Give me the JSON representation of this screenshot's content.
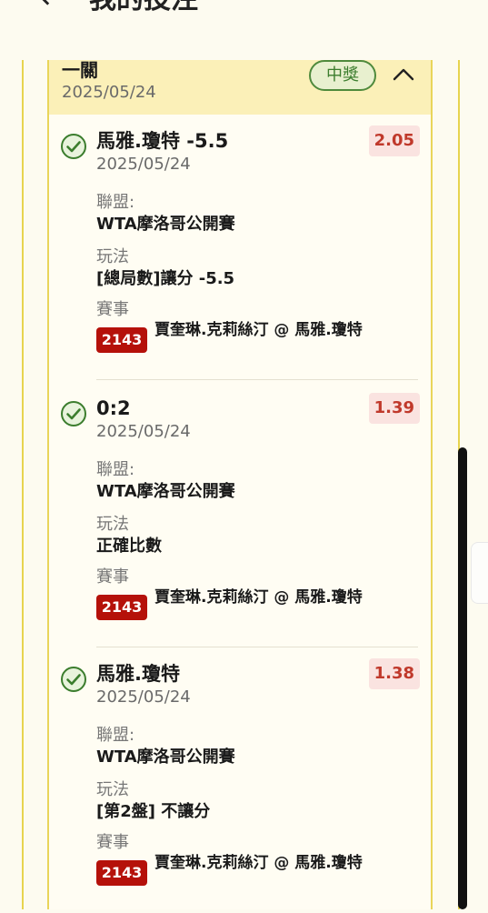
{
  "header": {
    "back_icon": "back-arrow-icon",
    "title": "我的投注"
  },
  "bet": {
    "title": "一關",
    "date": "2025/05/24",
    "status": "中獎",
    "status_color": "#3b7d2d",
    "collapse_icon": "chevron-up-icon"
  },
  "labels": {
    "league": "聯盟:",
    "play": "玩法",
    "event": "賽事"
  },
  "items": [
    {
      "name": "馬雅.瓊特 -5.5",
      "date": "2025/05/24",
      "odds": "2.05",
      "league": "WTA摩洛哥公開賽",
      "play": "[總局數]讓分 -5.5",
      "event_id": "2143",
      "event": "賈奎琳.克莉絲汀 @ 馬雅.瓊特"
    },
    {
      "name": "0:2",
      "date": "2025/05/24",
      "odds": "1.39",
      "league": "WTA摩洛哥公開賽",
      "play": "正確比數",
      "event_id": "2143",
      "event": "賈奎琳.克莉絲汀 @ 馬雅.瓊特"
    },
    {
      "name": "馬雅.瓊特",
      "date": "2025/05/24",
      "odds": "1.38",
      "league": "WTA摩洛哥公開賽",
      "play": "[第2盤] 不讓分",
      "event_id": "2143",
      "event": "賈奎琳.克莉絲汀 @ 馬雅.瓊特"
    }
  ],
  "colors": {
    "accent_border": "#e9d55a",
    "header_bg": "#fbf0b8",
    "odds": "#c0392b",
    "event_badge": "#b5110a"
  }
}
